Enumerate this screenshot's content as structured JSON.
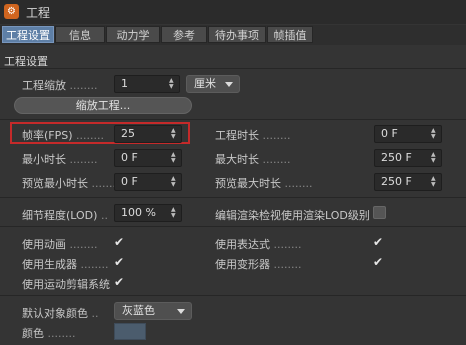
{
  "window": {
    "title": "工程",
    "icon": "gear-icon"
  },
  "tabs": [
    {
      "label": "工程设置",
      "active": true
    },
    {
      "label": "信息"
    },
    {
      "label": "动力学"
    },
    {
      "label": "参考"
    },
    {
      "label": "待办事项"
    },
    {
      "label": "帧插值"
    }
  ],
  "section_title": "工程设置",
  "scale": {
    "label": "工程缩放",
    "value": "1",
    "unit": "厘米",
    "button": "缩放工程..."
  },
  "fps": {
    "label": "帧率(FPS)",
    "value": "25"
  },
  "project_length": {
    "label": "工程时长",
    "value": "0 F"
  },
  "min_length": {
    "label": "最小时长",
    "value": "0 F"
  },
  "max_length": {
    "label": "最大时长",
    "value": "250 F"
  },
  "preview_min": {
    "label": "预览最小时长",
    "value": "0 F"
  },
  "preview_max": {
    "label": "预览最大时长",
    "value": "250 F"
  },
  "lod": {
    "label": "细节程度(LOD)",
    "value": "100 %"
  },
  "render_lod": {
    "label": "编辑渲染检视使用渲染LOD级别",
    "checked": false
  },
  "checks": {
    "animation": {
      "label": "使用动画",
      "checked": true
    },
    "expressions": {
      "label": "使用表达式",
      "checked": true
    },
    "generators": {
      "label": "使用生成器",
      "checked": true
    },
    "deformers": {
      "label": "使用变形器",
      "checked": true
    },
    "motion_clip": {
      "label": "使用运动剪辑系统",
      "checked": true
    }
  },
  "default_color": {
    "label": "默认对象颜色",
    "value": "灰蓝色"
  },
  "color": {
    "label": "颜色",
    "swatch": "#4b5c6d"
  },
  "colors": {
    "accent_tab": "#5e7fa6",
    "highlight": "#c52a2a",
    "background": "#343434"
  },
  "glyphs": {
    "dots": "........",
    "check": "✔",
    "up": "▲",
    "down": "▼"
  }
}
